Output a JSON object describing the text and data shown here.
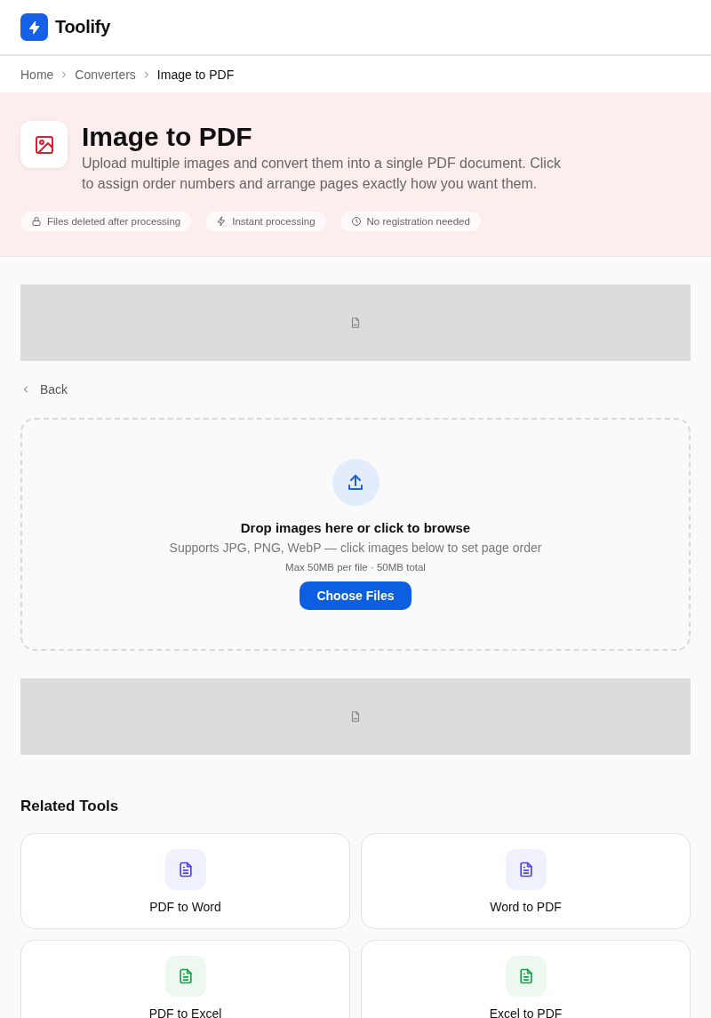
{
  "header": {
    "logo_text": "Toolify"
  },
  "breadcrumb": [
    {
      "label": "Home",
      "current": false
    },
    {
      "label": "Converters",
      "current": false
    },
    {
      "label": "Image to PDF",
      "current": true
    }
  ],
  "hero": {
    "title": "Image to PDF",
    "description": "Upload multiple images and convert them into a single PDF document. Click to assign order numbers and arrange pages exactly how you want them.",
    "badges": [
      {
        "kind": "lock",
        "label": "Files deleted after processing"
      },
      {
        "kind": "bolt",
        "label": "Instant processing"
      },
      {
        "kind": "clock",
        "label": "No registration needed"
      }
    ]
  },
  "ad_slots": [
    {
      "kind": "placeholder"
    },
    {
      "kind": "placeholder"
    }
  ],
  "back_link": "Back",
  "dropzone": {
    "title": "Drop images here or click to browse",
    "subtitle": "Supports JPG, PNG, WebP — click images below to set page order",
    "limits": "Max 50MB per file · 50MB total",
    "button": "Choose Files"
  },
  "related": {
    "title": "Related Tools",
    "tools": [
      {
        "label": "PDF to Word",
        "color": "#4f46e5"
      },
      {
        "label": "Word to PDF",
        "color": "#4f46e5"
      },
      {
        "label": "PDF to Excel",
        "color": "#16a34a"
      },
      {
        "label": "Excel to PDF",
        "color": "#16a34a"
      }
    ]
  }
}
